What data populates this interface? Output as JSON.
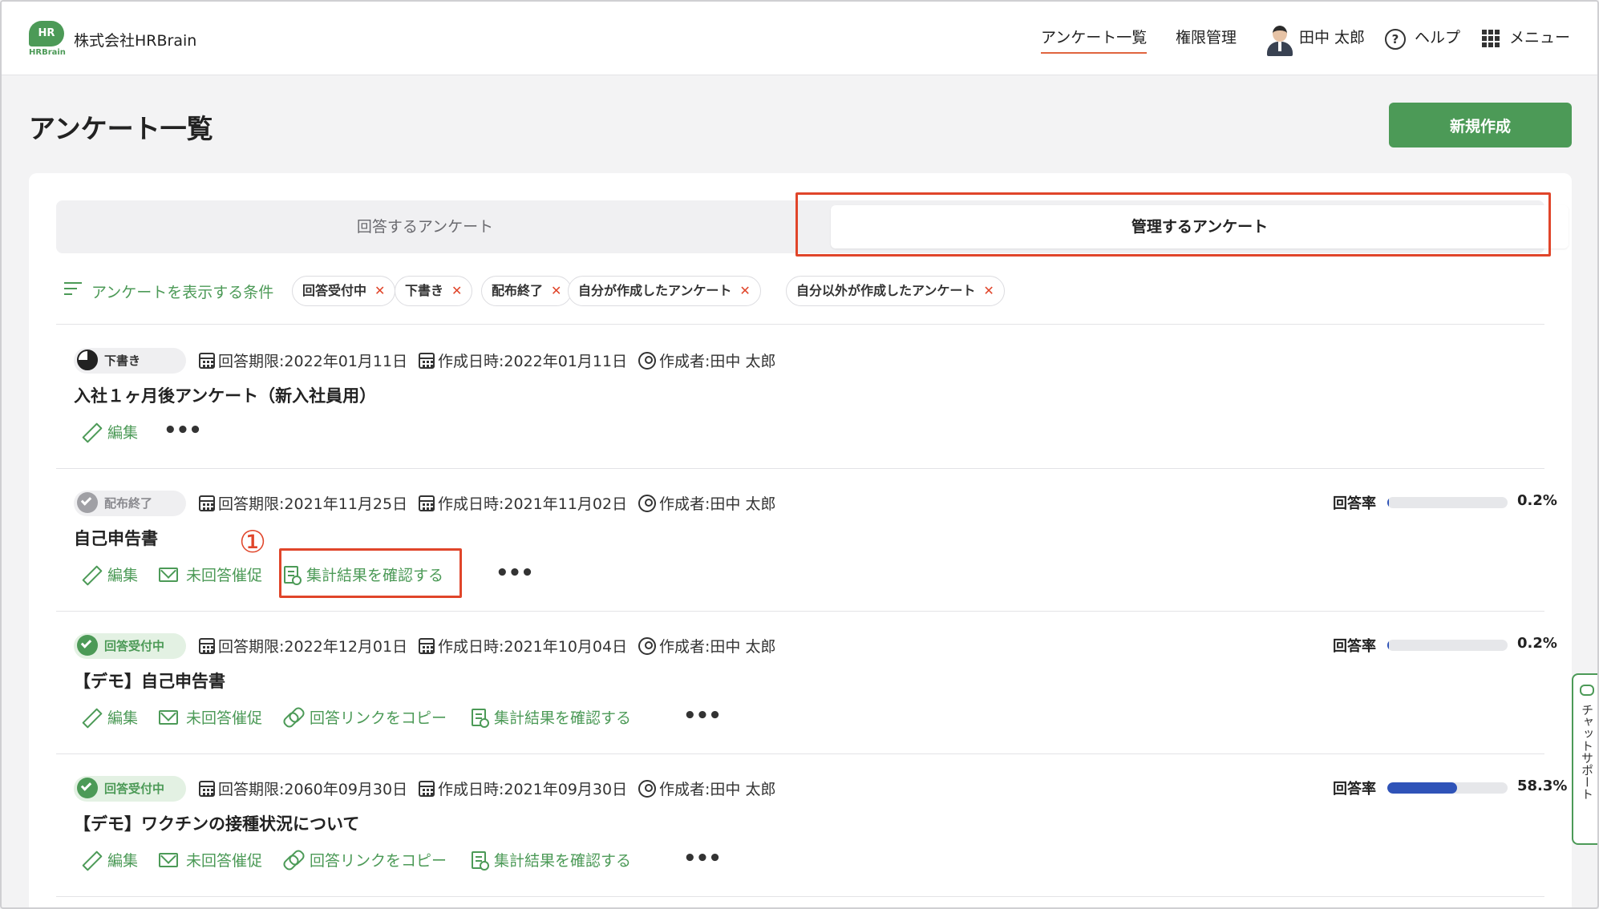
{
  "header": {
    "logo_text": "HR",
    "logo_sub": "HRBrain",
    "company": "株式会社HRBrain",
    "nav": {
      "surveys": "アンケート一覧",
      "permissions": "権限管理",
      "user": "田中 太郎",
      "help": "ヘルプ",
      "menu": "メニュー"
    }
  },
  "page": {
    "title": "アンケート一覧",
    "new_button": "新規作成"
  },
  "tabs": {
    "answer": "回答するアンケート",
    "manage": "管理するアンケート"
  },
  "filters": {
    "label": "アンケートを表示する条件",
    "chips": [
      "回答受付中",
      "下書き",
      "配布終了",
      "自分が作成したアンケート",
      "自分以外が作成したアンケート"
    ],
    "remove": "✕"
  },
  "surveys": [
    {
      "status": "下書き",
      "deadline": "回答期限:2022年01月11日",
      "created": "作成日時:2022年01月11日",
      "author": "作成者:田中 太郎",
      "title": "入社１ヶ月後アンケート（新入社員用）",
      "actions": [
        "編集"
      ],
      "rate": null
    },
    {
      "status": "配布終了",
      "deadline": "回答期限:2021年11月25日",
      "created": "作成日時:2021年11月02日",
      "author": "作成者:田中 太郎",
      "title": "自己申告書",
      "actions": [
        "編集",
        "未回答催促",
        "集計結果を確認する"
      ],
      "rate_label": "回答率",
      "rate": 0.2,
      "rate_text": "0.2%"
    },
    {
      "status": "回答受付中",
      "deadline": "回答期限:2022年12月01日",
      "created": "作成日時:2021年10月04日",
      "author": "作成者:田中 太郎",
      "title": "【デモ】自己申告書",
      "actions": [
        "編集",
        "未回答催促",
        "回答リンクをコピー",
        "集計結果を確認する"
      ],
      "rate_label": "回答率",
      "rate": 0.2,
      "rate_text": "0.2%"
    },
    {
      "status": "回答受付中",
      "deadline": "回答期限:2060年09月30日",
      "created": "作成日時:2021年09月30日",
      "author": "作成者:田中 太郎",
      "title": "【デモ】ワクチンの接種状況について",
      "actions": [
        "編集",
        "未回答催促",
        "回答リンクをコピー",
        "集計結果を確認する"
      ],
      "rate_label": "回答率",
      "rate": 58.3,
      "rate_text": "58.3%"
    }
  ],
  "annotation": "①",
  "chat_support": "チャットサポート",
  "more": "•••",
  "colors": {
    "brand": "#4c9a57",
    "highlight": "#e0452a",
    "progress": "#2f53b8"
  }
}
